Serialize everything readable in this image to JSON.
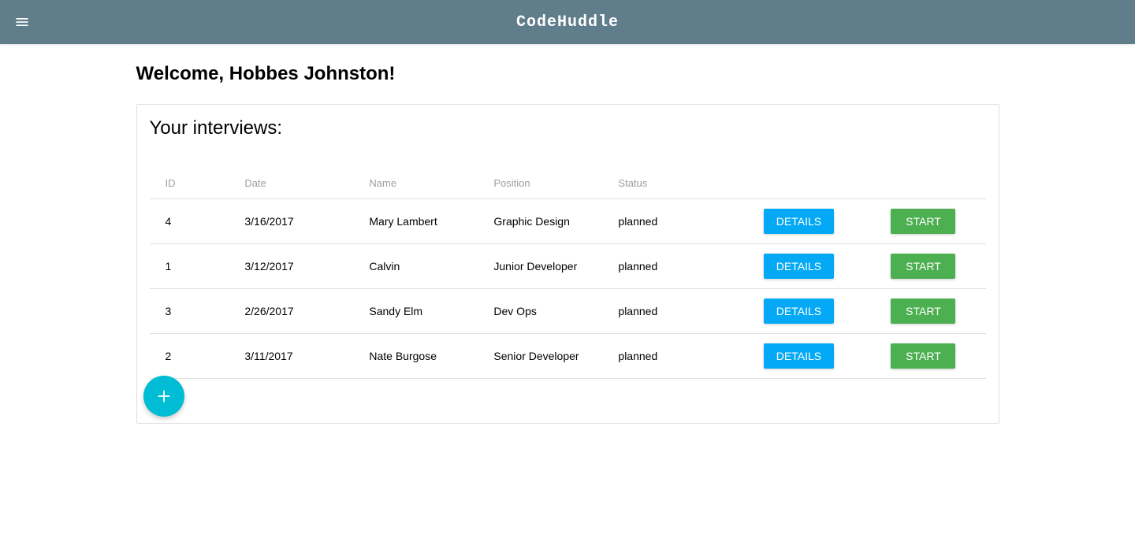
{
  "header": {
    "app_title": "CodeHuddle"
  },
  "main": {
    "welcome_heading": "Welcome, Hobbes Johnston!",
    "card_title": "Your interviews:",
    "columns": {
      "id": "ID",
      "date": "Date",
      "name": "Name",
      "position": "Position",
      "status": "Status"
    },
    "buttons": {
      "details": "DETAILS",
      "start": "START"
    },
    "interviews": [
      {
        "id": "4",
        "date": "3/16/2017",
        "name": "Mary Lambert",
        "position": "Graphic Design",
        "status": "planned"
      },
      {
        "id": "1",
        "date": "3/12/2017",
        "name": "Calvin",
        "position": "Junior Developer",
        "status": "planned"
      },
      {
        "id": "3",
        "date": "2/26/2017",
        "name": "Sandy Elm",
        "position": "Dev Ops",
        "status": "planned"
      },
      {
        "id": "2",
        "date": "3/11/2017",
        "name": "Nate Burgose",
        "position": "Senior Developer",
        "status": "planned"
      }
    ]
  }
}
